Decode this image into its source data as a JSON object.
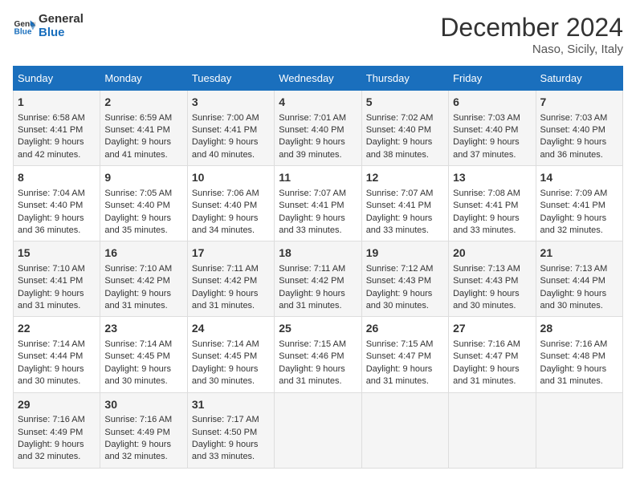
{
  "logo": {
    "text_general": "General",
    "text_blue": "Blue"
  },
  "header": {
    "title": "December 2024",
    "subtitle": "Naso, Sicily, Italy"
  },
  "weekdays": [
    "Sunday",
    "Monday",
    "Tuesday",
    "Wednesday",
    "Thursday",
    "Friday",
    "Saturday"
  ],
  "weeks": [
    [
      {
        "day": "1",
        "sunrise": "6:58 AM",
        "sunset": "4:41 PM",
        "daylight": "9 hours and 42 minutes."
      },
      {
        "day": "2",
        "sunrise": "6:59 AM",
        "sunset": "4:41 PM",
        "daylight": "9 hours and 41 minutes."
      },
      {
        "day": "3",
        "sunrise": "7:00 AM",
        "sunset": "4:41 PM",
        "daylight": "9 hours and 40 minutes."
      },
      {
        "day": "4",
        "sunrise": "7:01 AM",
        "sunset": "4:40 PM",
        "daylight": "9 hours and 39 minutes."
      },
      {
        "day": "5",
        "sunrise": "7:02 AM",
        "sunset": "4:40 PM",
        "daylight": "9 hours and 38 minutes."
      },
      {
        "day": "6",
        "sunrise": "7:03 AM",
        "sunset": "4:40 PM",
        "daylight": "9 hours and 37 minutes."
      },
      {
        "day": "7",
        "sunrise": "7:03 AM",
        "sunset": "4:40 PM",
        "daylight": "9 hours and 36 minutes."
      }
    ],
    [
      {
        "day": "8",
        "sunrise": "7:04 AM",
        "sunset": "4:40 PM",
        "daylight": "9 hours and 36 minutes."
      },
      {
        "day": "9",
        "sunrise": "7:05 AM",
        "sunset": "4:40 PM",
        "daylight": "9 hours and 35 minutes."
      },
      {
        "day": "10",
        "sunrise": "7:06 AM",
        "sunset": "4:40 PM",
        "daylight": "9 hours and 34 minutes."
      },
      {
        "day": "11",
        "sunrise": "7:07 AM",
        "sunset": "4:41 PM",
        "daylight": "9 hours and 33 minutes."
      },
      {
        "day": "12",
        "sunrise": "7:07 AM",
        "sunset": "4:41 PM",
        "daylight": "9 hours and 33 minutes."
      },
      {
        "day": "13",
        "sunrise": "7:08 AM",
        "sunset": "4:41 PM",
        "daylight": "9 hours and 33 minutes."
      },
      {
        "day": "14",
        "sunrise": "7:09 AM",
        "sunset": "4:41 PM",
        "daylight": "9 hours and 32 minutes."
      }
    ],
    [
      {
        "day": "15",
        "sunrise": "7:10 AM",
        "sunset": "4:41 PM",
        "daylight": "9 hours and 31 minutes."
      },
      {
        "day": "16",
        "sunrise": "7:10 AM",
        "sunset": "4:42 PM",
        "daylight": "9 hours and 31 minutes."
      },
      {
        "day": "17",
        "sunrise": "7:11 AM",
        "sunset": "4:42 PM",
        "daylight": "9 hours and 31 minutes."
      },
      {
        "day": "18",
        "sunrise": "7:11 AM",
        "sunset": "4:42 PM",
        "daylight": "9 hours and 31 minutes."
      },
      {
        "day": "19",
        "sunrise": "7:12 AM",
        "sunset": "4:43 PM",
        "daylight": "9 hours and 30 minutes."
      },
      {
        "day": "20",
        "sunrise": "7:13 AM",
        "sunset": "4:43 PM",
        "daylight": "9 hours and 30 minutes."
      },
      {
        "day": "21",
        "sunrise": "7:13 AM",
        "sunset": "4:44 PM",
        "daylight": "9 hours and 30 minutes."
      }
    ],
    [
      {
        "day": "22",
        "sunrise": "7:14 AM",
        "sunset": "4:44 PM",
        "daylight": "9 hours and 30 minutes."
      },
      {
        "day": "23",
        "sunrise": "7:14 AM",
        "sunset": "4:45 PM",
        "daylight": "9 hours and 30 minutes."
      },
      {
        "day": "24",
        "sunrise": "7:14 AM",
        "sunset": "4:45 PM",
        "daylight": "9 hours and 30 minutes."
      },
      {
        "day": "25",
        "sunrise": "7:15 AM",
        "sunset": "4:46 PM",
        "daylight": "9 hours and 31 minutes."
      },
      {
        "day": "26",
        "sunrise": "7:15 AM",
        "sunset": "4:47 PM",
        "daylight": "9 hours and 31 minutes."
      },
      {
        "day": "27",
        "sunrise": "7:16 AM",
        "sunset": "4:47 PM",
        "daylight": "9 hours and 31 minutes."
      },
      {
        "day": "28",
        "sunrise": "7:16 AM",
        "sunset": "4:48 PM",
        "daylight": "9 hours and 31 minutes."
      }
    ],
    [
      {
        "day": "29",
        "sunrise": "7:16 AM",
        "sunset": "4:49 PM",
        "daylight": "9 hours and 32 minutes."
      },
      {
        "day": "30",
        "sunrise": "7:16 AM",
        "sunset": "4:49 PM",
        "daylight": "9 hours and 32 minutes."
      },
      {
        "day": "31",
        "sunrise": "7:17 AM",
        "sunset": "4:50 PM",
        "daylight": "9 hours and 33 minutes."
      },
      null,
      null,
      null,
      null
    ]
  ],
  "labels": {
    "sunrise": "Sunrise:",
    "sunset": "Sunset:",
    "daylight": "Daylight:"
  }
}
